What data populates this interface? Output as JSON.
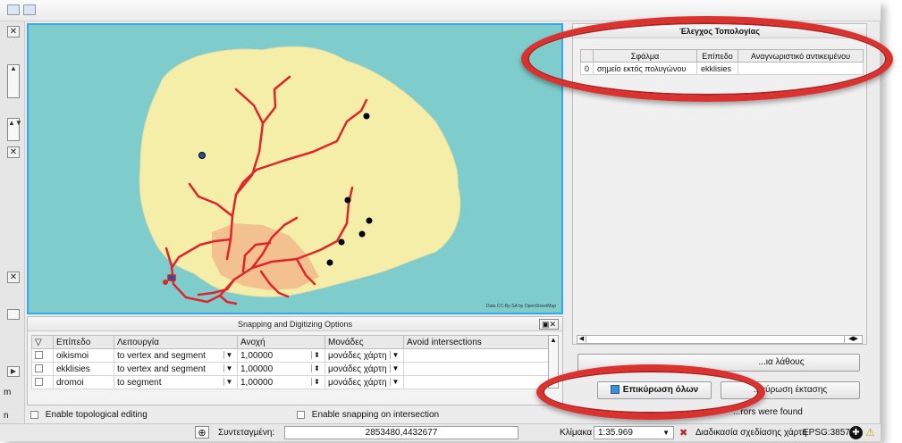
{
  "map": {
    "attribution": "Data CC-By-SA by OpenStreetMap",
    "colors": {
      "sea": "#7ecdcc",
      "land": "#f5eea8",
      "road": "#e0252a",
      "urban": "#f2b98b"
    }
  },
  "snapping": {
    "title": "Snapping and Digitizing Options",
    "columns": [
      "Επίπεδο",
      "Λειτουργία",
      "Ανοχή",
      "Μονάδες",
      "Avoid intersections"
    ],
    "rows": [
      {
        "layer": "oikismoi",
        "mode": "to vertex and segment",
        "tolerance": "1,00000",
        "units": "μονάδες χάρτη"
      },
      {
        "layer": "ekklisies",
        "mode": "to vertex and segment",
        "tolerance": "1,00000",
        "units": "μονάδες χάρτη"
      },
      {
        "layer": "dromoi",
        "mode": "to segment",
        "tolerance": "1,00000",
        "units": "μονάδες χάρτη"
      }
    ],
    "enable_topological_editing": "Enable topological editing",
    "enable_snapping_intersection": "Enable snapping on intersection"
  },
  "topology": {
    "title": "Έλεγχος Τοπολογίας",
    "columns": [
      "Σφάλμα",
      "Επίπεδο",
      "Αναγνωριστικό αντικειμένου"
    ],
    "rows": [
      {
        "index": "0",
        "error": "σημείο εκτός πολυγώνου",
        "layer": "ekklisies",
        "feature_id": ""
      }
    ],
    "show_errors_label": "...ια λάθους",
    "validate_all_label": "Επικύρωση όλων",
    "validate_extent_label": "...κύρωση έκτασης",
    "errors_found_label": "...rors were found"
  },
  "statusbar": {
    "coordinate_label": "Συντεταγμένη:",
    "coordinate_value": "2853480,4432677",
    "scale_label": "Κλίμακα",
    "scale_value": "1:35.969",
    "render_label": "Διαδικασία σχεδίασης χάρτη",
    "crs_label": "EPSG:3857"
  },
  "left": {
    "stub_m": "m",
    "stub_n": "n"
  }
}
